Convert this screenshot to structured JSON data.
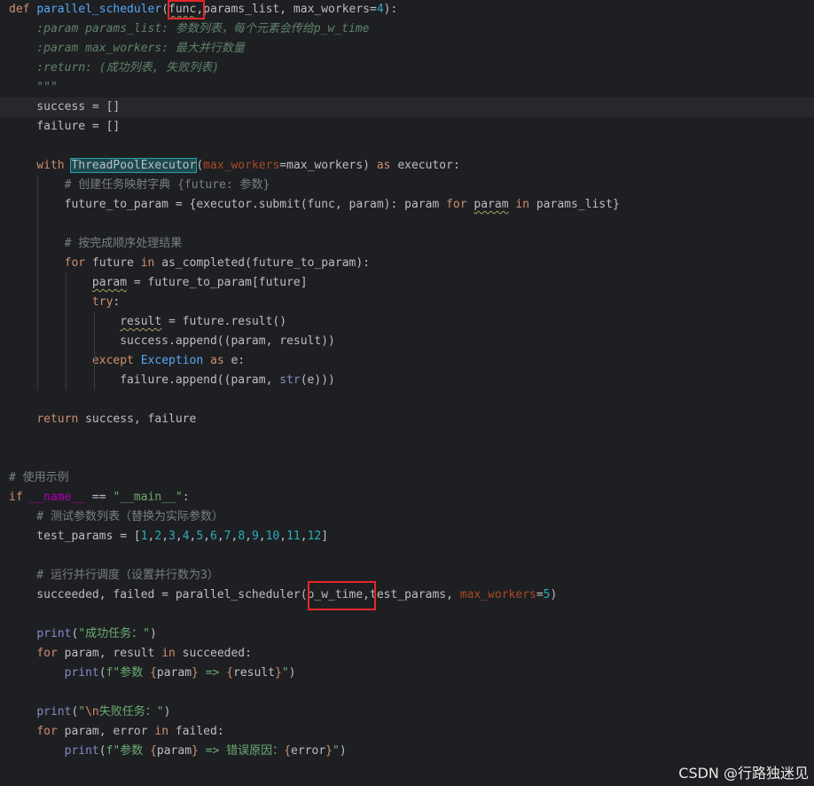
{
  "editor": {
    "lines": [
      [
        "def ",
        "parallel_scheduler",
        "(",
        "func",
        ",params_list, max_workers=",
        "4",
        "):"
      ],
      [
        "    :param params_list: 参数列表，每个元素会传给p_w_time"
      ],
      [
        "    :param max_workers: 最大并行数量"
      ],
      [
        "    :return: (成功列表, 失败列表)"
      ],
      [
        "    \"\"\""
      ],
      [
        "    success = []"
      ],
      [
        "    failure = []"
      ],
      [
        ""
      ],
      [
        "    with ",
        "ThreadPoolExecutor",
        "(",
        "max_workers",
        "=max_workers) ",
        "as",
        " executor:"
      ],
      [
        "        # 创建任务映射字典 {future: 参数}"
      ],
      [
        "        future_to_param = {executor.submit(func, param): param ",
        "for",
        " ",
        "param",
        " ",
        "in",
        " params_list}"
      ],
      [
        ""
      ],
      [
        "        # 按完成顺序处理结果"
      ],
      [
        "        ",
        "for",
        " future ",
        "in",
        " as_completed(future_to_param):"
      ],
      [
        "            ",
        "param",
        " = future_to_param[future]"
      ],
      [
        "            ",
        "try",
        ":"
      ],
      [
        "                ",
        "result",
        " = future.result()"
      ],
      [
        "                success.append((param, result))"
      ],
      [
        "            ",
        "except",
        " ",
        "Exception",
        " ",
        "as",
        " e:"
      ],
      [
        "                failure.append((param, ",
        "str",
        "(e)))"
      ],
      [
        ""
      ],
      [
        "    ",
        "return",
        " success, failure"
      ],
      [
        ""
      ],
      [
        ""
      ],
      [
        "# 使用示例"
      ],
      [
        "if",
        " ",
        "__name__",
        " == ",
        "\"__main__\"",
        ":"
      ],
      [
        "    # 测试参数列表（替换为实际参数）"
      ],
      [
        "    test_params = [",
        "1",
        ",",
        "2",
        ",",
        "3",
        ",",
        "4",
        ",",
        "5",
        ",",
        "6",
        ",",
        "7",
        ",",
        "8",
        ",",
        "9",
        ",",
        "10",
        ",",
        "11",
        ",",
        "12",
        "]"
      ],
      [
        ""
      ],
      [
        "    # 运行并行调度（设置并行数为3）"
      ],
      [
        "    succeeded, failed = parallel_scheduler(",
        "p_w_time",
        ",test_params, ",
        "max_workers",
        "=",
        "5",
        ")"
      ],
      [
        ""
      ],
      [
        "    ",
        "print",
        "(",
        "\"成功任务：\"",
        ")"
      ],
      [
        "    ",
        "for",
        " param, result ",
        "in",
        " succeeded:"
      ],
      [
        "        ",
        "print",
        "(",
        "f\"参数 ",
        "{",
        "param",
        "}",
        " => ",
        "{",
        "result",
        "}",
        "\"",
        ")"
      ],
      [
        ""
      ],
      [
        "    ",
        "print",
        "(",
        "\"",
        "\\n",
        "失败任务：\"",
        ")"
      ],
      [
        "    ",
        "for",
        " param, error ",
        "in",
        " failed:"
      ],
      [
        "        ",
        "print",
        "(",
        "f\"参数 ",
        "{",
        "param",
        "}",
        " => 错误原因：",
        "{",
        "error",
        "}",
        "\"",
        ")"
      ]
    ],
    "token_classes": [
      [
        "kw",
        "fn",
        "",
        "wavy",
        "",
        "num",
        ""
      ],
      [
        "doc"
      ],
      [
        "doc"
      ],
      [
        "doc"
      ],
      [
        "doc"
      ],
      [
        ""
      ],
      [
        ""
      ],
      [
        ""
      ],
      [
        "kw",
        "cls",
        "",
        "param",
        "",
        "kw",
        ""
      ],
      [
        "cmt"
      ],
      [
        "",
        "kw",
        "",
        "wavy",
        "",
        "kw",
        ""
      ],
      [
        ""
      ],
      [
        "cmt"
      ],
      [
        "",
        "kw",
        "",
        "kw",
        ""
      ],
      [
        "",
        "wavy",
        ""
      ],
      [
        "",
        "kw",
        ""
      ],
      [
        "",
        "wavy",
        ""
      ],
      [
        ""
      ],
      [
        "",
        "kw",
        "",
        "cls2",
        "",
        "kw",
        ""
      ],
      [
        "",
        "builtin",
        ""
      ],
      [
        ""
      ],
      [
        "",
        "kw",
        ""
      ],
      [
        ""
      ],
      [
        ""
      ],
      [
        "cmt"
      ],
      [
        "kw",
        "",
        "dunder",
        "",
        "str",
        ""
      ],
      [
        "cmt"
      ],
      [
        "",
        "num",
        "",
        "num",
        "",
        "num",
        "",
        "num",
        "",
        "num",
        "",
        "num",
        "",
        "num",
        "",
        "num",
        "",
        "num",
        "",
        "num",
        "",
        "num",
        "",
        "num",
        ""
      ],
      [
        ""
      ],
      [
        "cmt"
      ],
      [
        "",
        "",
        "",
        "param",
        "",
        "num",
        ""
      ],
      [
        ""
      ],
      [
        "",
        "builtin",
        "",
        "str",
        ""
      ],
      [
        "",
        "kw",
        "",
        "kw",
        ""
      ],
      [
        "",
        "builtin",
        "",
        "str",
        "kw",
        "",
        "kw",
        "str",
        "kw",
        "",
        "kw",
        "str",
        ""
      ],
      [
        ""
      ],
      [
        "",
        "builtin",
        "",
        "str",
        "kw",
        "str",
        ""
      ],
      [
        "",
        "kw",
        "",
        "kw",
        ""
      ],
      [
        "",
        "builtin",
        "",
        "str",
        "kw",
        "",
        "kw",
        "str",
        "kw",
        "",
        "kw",
        "str",
        ""
      ]
    ]
  },
  "watermark": "CSDN @行路独迷见"
}
